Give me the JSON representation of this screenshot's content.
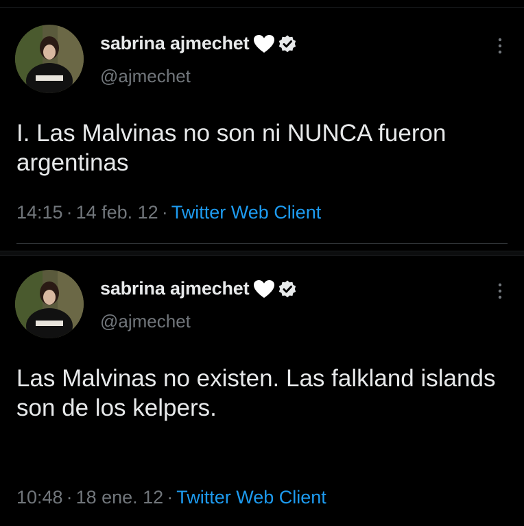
{
  "colors": {
    "background": "#000000",
    "text_primary": "#e7e9ea",
    "text_secondary": "#71767b",
    "link": "#1d9bf0",
    "divider": "#2f3336"
  },
  "icons": {
    "heart": "white-heart-icon",
    "verified": "verified-badge-icon",
    "more": "more-vertical-icon"
  },
  "tweets": [
    {
      "display_name": "sabrina ajmechet",
      "handle": "@ajmechet",
      "text": "I. Las Malvinas no son ni NUNCA fueron argentinas",
      "time": "14:15",
      "date": "14 feb. 12",
      "separator": "·",
      "client": "Twitter Web Client"
    },
    {
      "display_name": "sabrina ajmechet",
      "handle": "@ajmechet",
      "text": "Las Malvinas no existen. Las falkland islands son de los kelpers.",
      "time": "10:48",
      "date": "18 ene. 12",
      "separator": "·",
      "client": "Twitter Web Client"
    }
  ]
}
